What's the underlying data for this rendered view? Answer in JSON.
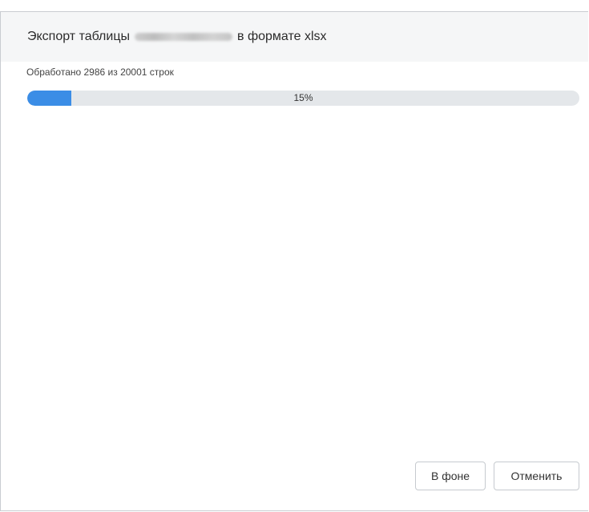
{
  "dialog": {
    "title_prefix": "Экспорт таблицы",
    "title_suffix": "в формате xlsx"
  },
  "progress": {
    "label": "Обработано 2986 из 20001 строк",
    "percent_text": "15%",
    "fraction": 0.08
  },
  "buttons": {
    "background_label": "В фоне",
    "cancel_label": "Отменить"
  },
  "colors": {
    "accent": "#3b8de6",
    "track": "#e4e7ea",
    "header_bg": "#f5f6f7"
  }
}
